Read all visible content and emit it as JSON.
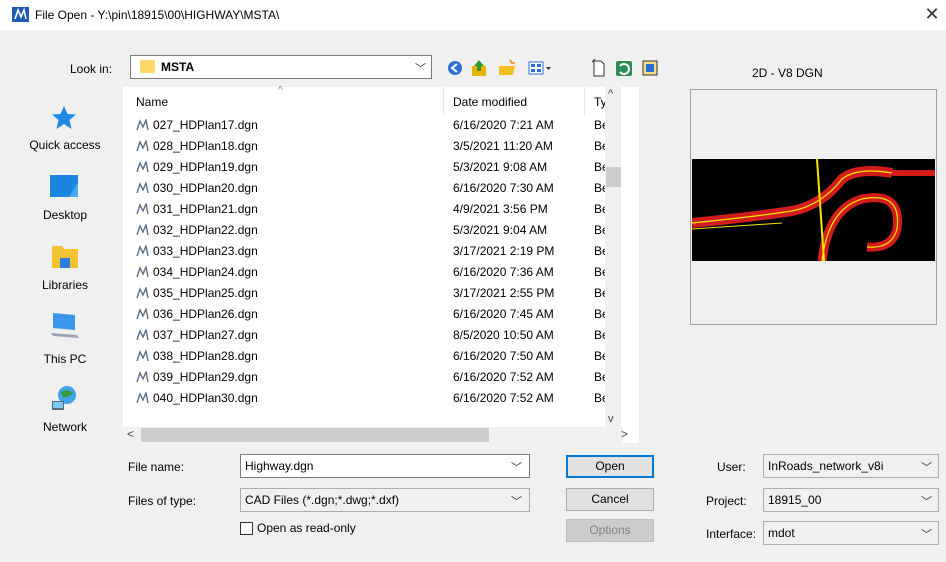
{
  "window": {
    "title": "File Open - Y:\\pin\\18915\\00\\HIGHWAY\\MSTA\\",
    "close_glyph": "✕"
  },
  "look_in": {
    "label": "Look in:",
    "value": "MSTA"
  },
  "toolbar": {
    "icons": [
      "back-icon",
      "up-folder-icon",
      "new-folder-icon",
      "view-menu-icon",
      "new-file-icon",
      "refresh-icon",
      "preview-toggle-icon"
    ]
  },
  "preview": {
    "label": "2D - V8 DGN"
  },
  "places": [
    {
      "label": "Quick access",
      "icon": "star-icon"
    },
    {
      "label": "Desktop",
      "icon": "desktop-icon"
    },
    {
      "label": "Libraries",
      "icon": "libraries-icon"
    },
    {
      "label": "This PC",
      "icon": "computer-icon"
    },
    {
      "label": "Network",
      "icon": "network-icon"
    }
  ],
  "file_list": {
    "columns": [
      "Name",
      "Date modified",
      "Type"
    ],
    "rows": [
      {
        "name": "027_HDPlan17.dgn",
        "date": "6/16/2020 7:21 AM",
        "type": "Bentley"
      },
      {
        "name": "028_HDPlan18.dgn",
        "date": "3/5/2021 11:20 AM",
        "type": "Bentley"
      },
      {
        "name": "029_HDPlan19.dgn",
        "date": "5/3/2021 9:08 AM",
        "type": "Bentley"
      },
      {
        "name": "030_HDPlan20.dgn",
        "date": "6/16/2020 7:30 AM",
        "type": "Bentley"
      },
      {
        "name": "031_HDPlan21.dgn",
        "date": "4/9/2021 3:56 PM",
        "type": "Bentley"
      },
      {
        "name": "032_HDPlan22.dgn",
        "date": "5/3/2021 9:04 AM",
        "type": "Bentley"
      },
      {
        "name": "033_HDPlan23.dgn",
        "date": "3/17/2021 2:19 PM",
        "type": "Bentley"
      },
      {
        "name": "034_HDPlan24.dgn",
        "date": "6/16/2020 7:36 AM",
        "type": "Bentley"
      },
      {
        "name": "035_HDPlan25.dgn",
        "date": "3/17/2021 2:55 PM",
        "type": "Bentley"
      },
      {
        "name": "036_HDPlan26.dgn",
        "date": "6/16/2020 7:45 AM",
        "type": "Bentley"
      },
      {
        "name": "037_HDPlan27.dgn",
        "date": "8/5/2020 10:50 AM",
        "type": "Bentley"
      },
      {
        "name": "038_HDPlan28.dgn",
        "date": "6/16/2020 7:50 AM",
        "type": "Bentley"
      },
      {
        "name": "039_HDPlan29.dgn",
        "date": "6/16/2020 7:52 AM",
        "type": "Bentley"
      },
      {
        "name": "040_HDPlan30.dgn",
        "date": "6/16/2020 7:52 AM",
        "type": "Bentley"
      }
    ]
  },
  "form": {
    "file_name_label": "File name:",
    "file_name_value": "Highway.dgn",
    "files_of_type_label": "Files of type:",
    "files_of_type_value": "CAD Files (*.dgn;*.dwg;*.dxf)",
    "readonly_label": "Open as read-only",
    "readonly_checked": false
  },
  "buttons": {
    "open": "Open",
    "cancel": "Cancel",
    "options": "Options"
  },
  "workspace": {
    "user_label": "User:",
    "user_value": "InRoads_network_v8i",
    "project_label": "Project:",
    "project_value": "18915_00",
    "interface_label": "Interface:",
    "interface_value": "mdot"
  }
}
